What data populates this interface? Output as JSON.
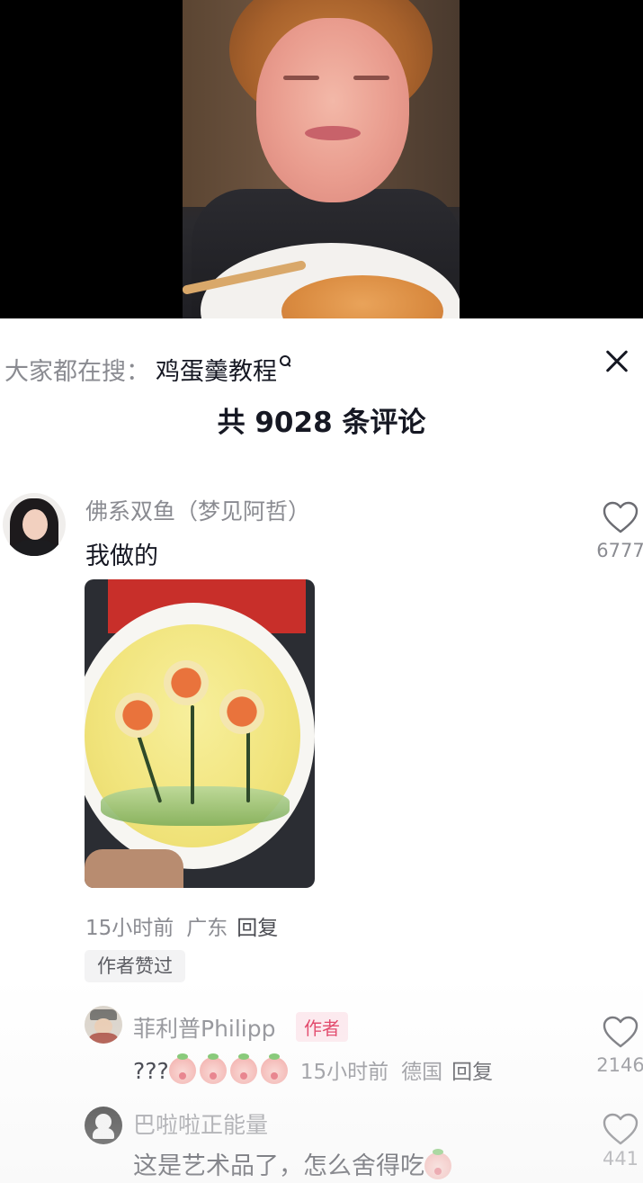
{
  "search": {
    "prefix": "大家都在搜：",
    "keyword": "鸡蛋羹教程"
  },
  "header": {
    "comment_count": "共 9028 条评论"
  },
  "comments": [
    {
      "user": "佛系双鱼（梦见阿哲）",
      "text": "我做的",
      "time": "15小时前",
      "location": "广东",
      "reply_label": "回复",
      "likes": "6777",
      "tag": "作者赞过",
      "replies": [
        {
          "user": "菲利普Philipp",
          "badge": "作者",
          "text": "???",
          "emoji_count": 4,
          "time": "15小时前",
          "location": "德国",
          "reply_label": "回复",
          "likes": "2146"
        },
        {
          "user": "巴啦啦正能量",
          "text": "这是艺术品了，怎么舍得吃",
          "emoji_count": 1,
          "likes": "441"
        }
      ]
    }
  ],
  "icons": {
    "search": "search-icon",
    "close": "close-icon",
    "like": "heart-icon",
    "emoji": "peach-emoji-icon"
  },
  "colors": {
    "text_primary": "#161823",
    "text_secondary": "#8a8b91",
    "author_badge": "#e0335a"
  }
}
